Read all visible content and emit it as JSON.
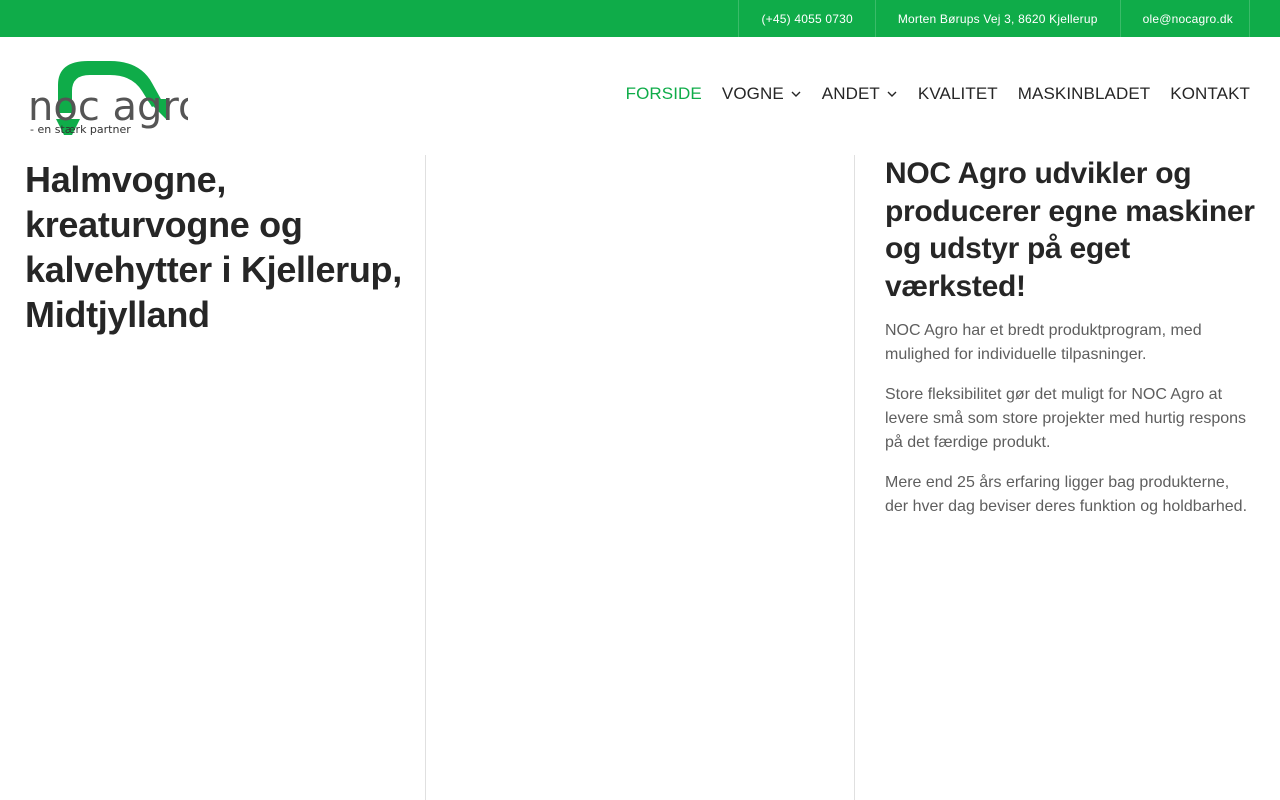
{
  "topbar": {
    "phone": "(+45) 4055 0730",
    "address": "Morten Børups Vej 3, 8620 Kjellerup",
    "email": "ole@nocagro.dk"
  },
  "logo": {
    "text": "noc agro",
    "tagline": "- en stærk partner",
    "icon": "green-arc-logo-icon"
  },
  "nav": {
    "items": [
      {
        "label": "FORSIDE",
        "active": true,
        "has_dropdown": false
      },
      {
        "label": "VOGNE",
        "active": false,
        "has_dropdown": true
      },
      {
        "label": "ANDET",
        "active": false,
        "has_dropdown": true
      },
      {
        "label": "KVALITET",
        "active": false,
        "has_dropdown": false
      },
      {
        "label": "MASKINBLADET",
        "active": false,
        "has_dropdown": false
      },
      {
        "label": "KONTAKT",
        "active": false,
        "has_dropdown": false
      }
    ]
  },
  "main": {
    "left_heading": "Halmvogne, kreaturvogne og kalvehytter i Kjellerup, Midtjylland",
    "right_heading": "NOC Agro udvikler og producerer egne maskiner og udstyr på eget værksted!",
    "paragraphs": [
      "NOC Agro har et bredt produktprogram, med mulighed for individuelle tilpasninger.",
      "Store fleksibilitet gør det muligt for NOC Agro at levere små som store projekter med hurtig respons på det færdige produkt.",
      "Mere end 25 års erfaring ligger bag produkterne, der hver dag beviser deres funktion og holdbarhed."
    ]
  },
  "colors": {
    "brand_green": "#0fac49",
    "text_dark": "#262626",
    "text_body": "#5e5e5e",
    "logo_gray": "#555555"
  }
}
